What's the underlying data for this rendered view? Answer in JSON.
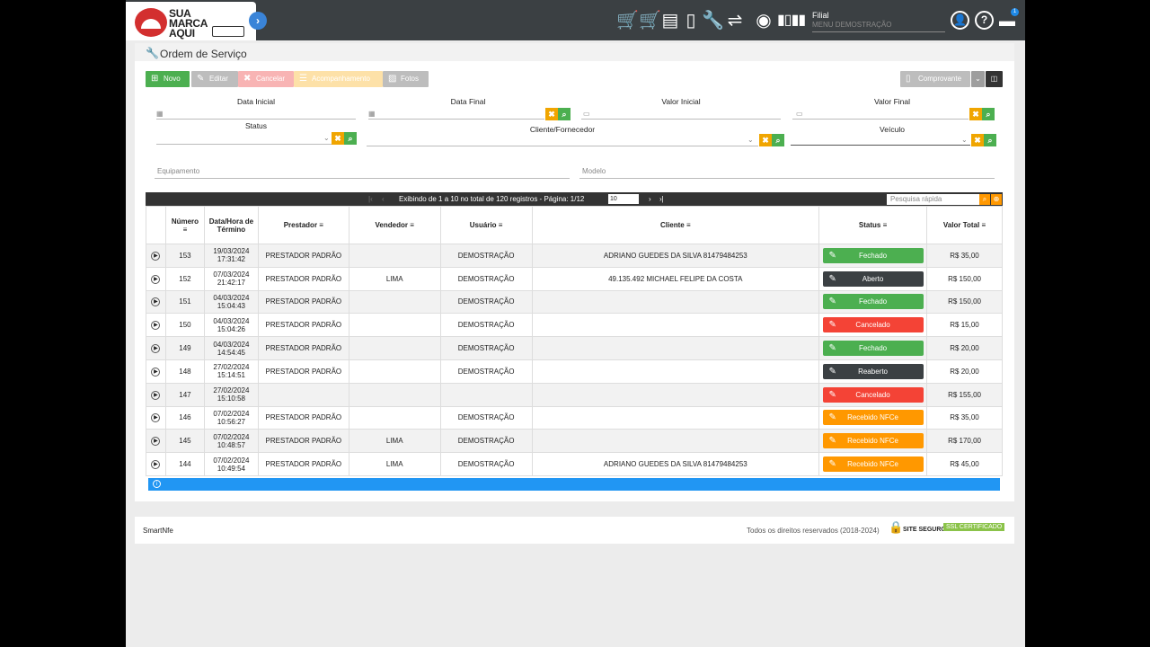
{
  "brand": {
    "line1": "SUA",
    "line2": "MARCA",
    "line3": "AQUI"
  },
  "header": {
    "filial_label": "Filial",
    "filial_value": "MENU DEMOSTRAÇÃO",
    "notification_count": "1"
  },
  "page": {
    "title": "Ordem de Serviço"
  },
  "toolbar": {
    "novo": "Novo",
    "editar": "Editar",
    "cancelar": "Cancelar",
    "acompanhamento": "Acompanhamento",
    "fotos": "Fotos",
    "comprovante": "Comprovante"
  },
  "filters": {
    "data_inicial": "Data Inicial",
    "data_final": "Data Final",
    "valor_inicial": "Valor Inicial",
    "valor_final": "Valor Final",
    "status": "Status",
    "cliente": "Cliente/Fornecedor",
    "veiculo": "Veículo",
    "equipamento": "Equipamento",
    "modelo": "Modelo"
  },
  "pagination": {
    "info": "Exibindo de 1 a 10 no total de 120 registros - Página: 1/12",
    "page_size": "10",
    "search_placeholder": "Pesquisa rápida"
  },
  "columns": {
    "numero": "Número",
    "data": "Data/Hora de Término",
    "prestador": "Prestador",
    "vendedor": "Vendedor",
    "usuario": "Usuário",
    "cliente": "Cliente",
    "status": "Status",
    "valor": "Valor Total"
  },
  "rows": [
    {
      "numero": "153",
      "data": "19/03/2024",
      "hora": "17:31:42",
      "prestador": "PRESTADOR PADRÃO",
      "vendedor": "",
      "usuario": "DEMOSTRAÇÃO",
      "cliente": "ADRIANO GUEDES DA SILVA 81479484253",
      "status": "Fechado",
      "color": "#4caf50",
      "valor": "R$ 35,00"
    },
    {
      "numero": "152",
      "data": "07/03/2024",
      "hora": "21:42:17",
      "prestador": "PRESTADOR PADRÃO",
      "vendedor": "LIMA",
      "usuario": "DEMOSTRAÇÃO",
      "cliente": "49.135.492 MICHAEL FELIPE DA COSTA",
      "status": "Aberto",
      "color": "#3b4043",
      "valor": "R$ 150,00"
    },
    {
      "numero": "151",
      "data": "04/03/2024",
      "hora": "15:04:43",
      "prestador": "PRESTADOR PADRÃO",
      "vendedor": "",
      "usuario": "DEMOSTRAÇÃO",
      "cliente": "",
      "status": "Fechado",
      "color": "#4caf50",
      "valor": "R$ 150,00"
    },
    {
      "numero": "150",
      "data": "04/03/2024",
      "hora": "15:04:26",
      "prestador": "PRESTADOR PADRÃO",
      "vendedor": "",
      "usuario": "DEMOSTRAÇÃO",
      "cliente": "",
      "status": "Cancelado",
      "color": "#f44336",
      "valor": "R$ 15,00"
    },
    {
      "numero": "149",
      "data": "04/03/2024",
      "hora": "14:54:45",
      "prestador": "PRESTADOR PADRÃO",
      "vendedor": "",
      "usuario": "DEMOSTRAÇÃO",
      "cliente": "",
      "status": "Fechado",
      "color": "#4caf50",
      "valor": "R$ 20,00"
    },
    {
      "numero": "148",
      "data": "27/02/2024",
      "hora": "15:14:51",
      "prestador": "PRESTADOR PADRÃO",
      "vendedor": "",
      "usuario": "DEMOSTRAÇÃO",
      "cliente": "",
      "status": "Reaberto",
      "color": "#3b4043",
      "valor": "R$ 20,00"
    },
    {
      "numero": "147",
      "data": "27/02/2024",
      "hora": "15:10:58",
      "prestador": "",
      "vendedor": "",
      "usuario": "",
      "cliente": "",
      "status": "Cancelado",
      "color": "#f44336",
      "valor": "R$ 155,00"
    },
    {
      "numero": "146",
      "data": "07/02/2024",
      "hora": "10:56:27",
      "prestador": "PRESTADOR PADRÃO",
      "vendedor": "",
      "usuario": "DEMOSTRAÇÃO",
      "cliente": "",
      "status": "Recebido NFCe",
      "color": "#ff9800",
      "valor": "R$ 35,00"
    },
    {
      "numero": "145",
      "data": "07/02/2024",
      "hora": "10:48:57",
      "prestador": "PRESTADOR PADRÃO",
      "vendedor": "LIMA",
      "usuario": "DEMOSTRAÇÃO",
      "cliente": "",
      "status": "Recebido NFCe",
      "color": "#ff9800",
      "valor": "R$ 170,00"
    },
    {
      "numero": "144",
      "data": "07/02/2024",
      "hora": "10:49:54",
      "prestador": "PRESTADOR PADRÃO",
      "vendedor": "LIMA",
      "usuario": "DEMOSTRAÇÃO",
      "cliente": "ADRIANO GUEDES DA SILVA 81479484253",
      "status": "Recebido NFCe",
      "color": "#ff9800",
      "valor": "R$ 45,00"
    }
  ],
  "footer": {
    "app": "SmartNfe",
    "rights": "Todos os direitos reservados (2018-2024)",
    "site_seguro": "SITE SEGURO",
    "ssl": "SSL CERTIFICADO"
  }
}
